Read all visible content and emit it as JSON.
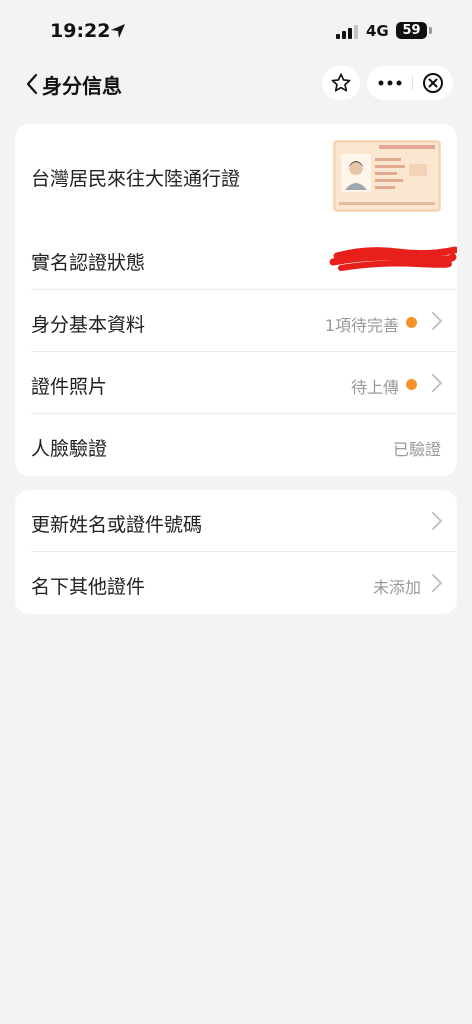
{
  "status_bar": {
    "time": "19:22",
    "network": "4G",
    "battery": "59"
  },
  "nav": {
    "title": "身分信息"
  },
  "card_identity": {
    "id_title": "台灣居民來往大陸通行證",
    "rows": [
      {
        "label": "實名認證狀態",
        "value": ""
      },
      {
        "label": "身分基本資料",
        "value": "1項待完善"
      },
      {
        "label": "證件照片",
        "value": "待上傳"
      },
      {
        "label": "人臉驗證",
        "value": "已驗證"
      }
    ]
  },
  "card_other": {
    "rows": [
      {
        "label": "更新姓名或證件號碼",
        "value": ""
      },
      {
        "label": "名下其他證件",
        "value": "未添加"
      }
    ]
  },
  "colors": {
    "pending_dot": "#f5922a",
    "redaction": "#e8201c",
    "background": "#f3f3f3"
  }
}
